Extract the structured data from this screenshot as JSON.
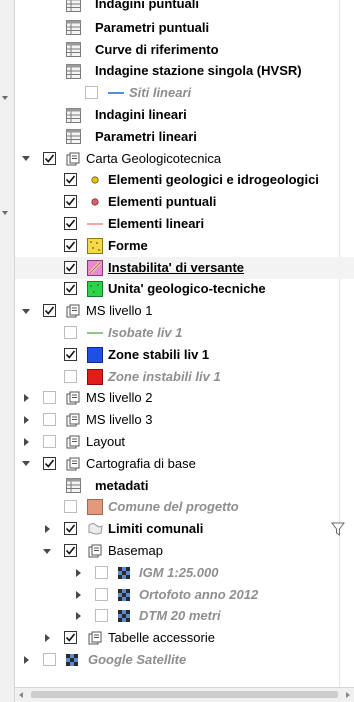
{
  "layers": [
    {
      "label": "Indagini puntuali",
      "icon": "table-icon",
      "style": "b",
      "indent": 3,
      "checkbox": "none",
      "expander": "none"
    },
    {
      "label": "Parametri puntuali",
      "icon": "table-icon",
      "style": "b",
      "indent": 3,
      "checkbox": "none",
      "expander": "none"
    },
    {
      "label": "Curve di riferimento",
      "icon": "table-icon",
      "style": "b",
      "indent": 3,
      "checkbox": "none",
      "expander": "none"
    },
    {
      "label": "Indagine stazione singola (HVSR)",
      "icon": "table-icon",
      "style": "b",
      "indent": 3,
      "checkbox": "none",
      "expander": "none"
    },
    {
      "label": "Siti lineari",
      "icon": "line-symbol-blue-icon",
      "style": "i",
      "indent": 3,
      "checkbox": "off",
      "expander": "none"
    },
    {
      "label": "Indagini lineari",
      "icon": "table-icon",
      "style": "b",
      "indent": 3,
      "checkbox": "none",
      "expander": "none"
    },
    {
      "label": "Parametri lineari",
      "icon": "table-icon",
      "style": "b",
      "indent": 3,
      "checkbox": "none",
      "expander": "none"
    },
    {
      "label": "Carta Geologicotecnica",
      "icon": "group-folder-icon",
      "style": "n",
      "indent": 1,
      "checkbox": "on",
      "expander": "down"
    },
    {
      "label": "Elementi geologici e idrogeologici",
      "icon": "yellow-dot-icon",
      "style": "b",
      "indent": 2,
      "checkbox": "on",
      "expander": "none"
    },
    {
      "label": "Elementi puntuali",
      "icon": "red-dot-icon",
      "style": "b",
      "indent": 2,
      "checkbox": "on",
      "expander": "none"
    },
    {
      "label": "Elementi lineari",
      "icon": "line-symbol-pink-icon",
      "style": "b",
      "indent": 2,
      "checkbox": "on",
      "expander": "none"
    },
    {
      "label": "Forme",
      "icon": "forme-pattern-icon",
      "style": "b",
      "indent": 2,
      "checkbox": "on",
      "expander": "none"
    },
    {
      "label": "Instabilita' di versante",
      "icon": "instability-pattern-icon",
      "style": "bu",
      "indent": 2,
      "checkbox": "on",
      "expander": "none",
      "selected": true
    },
    {
      "label": "Unita' geologico-tecniche",
      "icon": "green-pattern-icon",
      "style": "b",
      "indent": 2,
      "checkbox": "on",
      "expander": "none"
    },
    {
      "label": "MS livello 1",
      "icon": "group-folder-icon",
      "style": "n",
      "indent": 1,
      "checkbox": "on",
      "expander": "down"
    },
    {
      "label": "Isobate liv 1",
      "icon": "line-symbol-green-icon",
      "style": "i",
      "indent": 2,
      "checkbox": "off",
      "expander": "none"
    },
    {
      "label": "Zone stabili liv 1",
      "icon": "blue-fill-icon",
      "style": "b",
      "indent": 2,
      "checkbox": "on",
      "expander": "none"
    },
    {
      "label": "Zone instabili liv 1",
      "icon": "red-fill-icon",
      "style": "i",
      "indent": 2,
      "checkbox": "off",
      "expander": "none"
    },
    {
      "label": "MS livello 2",
      "icon": "group-folder-icon",
      "style": "n",
      "indent": 1,
      "checkbox": "off",
      "expander": "right"
    },
    {
      "label": "MS livello 3",
      "icon": "group-folder-icon",
      "style": "n",
      "indent": 1,
      "checkbox": "off",
      "expander": "right"
    },
    {
      "label": "Layout",
      "icon": "group-folder-icon",
      "style": "n",
      "indent": 1,
      "checkbox": "off",
      "expander": "right"
    },
    {
      "label": "Cartografia di base",
      "icon": "group-folder-icon",
      "style": "n",
      "indent": 1,
      "checkbox": "on",
      "expander": "down"
    },
    {
      "label": "metadati",
      "icon": "table-icon",
      "style": "b",
      "indent": 2,
      "checkbox": "none",
      "expander": "none"
    },
    {
      "label": "Comune del progetto",
      "icon": "salmon-fill-icon",
      "style": "i",
      "indent": 2,
      "checkbox": "off",
      "expander": "none"
    },
    {
      "label": "Limiti comunali",
      "icon": "polygon-outline-icon",
      "style": "b",
      "indent": 2,
      "checkbox": "on",
      "expander": "right",
      "filter": true
    },
    {
      "label": "Basemap",
      "icon": "group-folder-icon",
      "style": "n",
      "indent": 2,
      "checkbox": "on",
      "expander": "down"
    },
    {
      "label": "IGM 1:25.000",
      "icon": "raster-icon",
      "style": "i",
      "indent": 3,
      "checkbox": "off",
      "expander": "right"
    },
    {
      "label": "Ortofoto anno 2012",
      "icon": "raster-icon",
      "style": "i",
      "indent": 3,
      "checkbox": "off",
      "expander": "right"
    },
    {
      "label": "DTM 20 metri",
      "icon": "raster-icon",
      "style": "i",
      "indent": 3,
      "checkbox": "off",
      "expander": "right"
    },
    {
      "label": "Tabelle accessorie",
      "icon": "group-folder-icon",
      "style": "n",
      "indent": 2,
      "checkbox": "on",
      "expander": "right"
    },
    {
      "label": "Google Satellite",
      "icon": "raster-icon",
      "style": "i",
      "indent": 0,
      "checkbox": "off",
      "expander": "right"
    }
  ],
  "colors": {
    "line_blue": "#4d8fe0",
    "line_pink": "#f2a6a6",
    "line_green": "#8cc68c",
    "dot_yellow": "#e0c21c",
    "dot_red": "#d95f6a",
    "forme": "#f5d94a",
    "instability": "#e889d6",
    "green_fill": "#2fd34a",
    "blue_fill": "#1f4fe6",
    "red_fill": "#e21b1b",
    "salmon_fill": "#e39a7c",
    "selected_row": "#f3f3f3"
  }
}
